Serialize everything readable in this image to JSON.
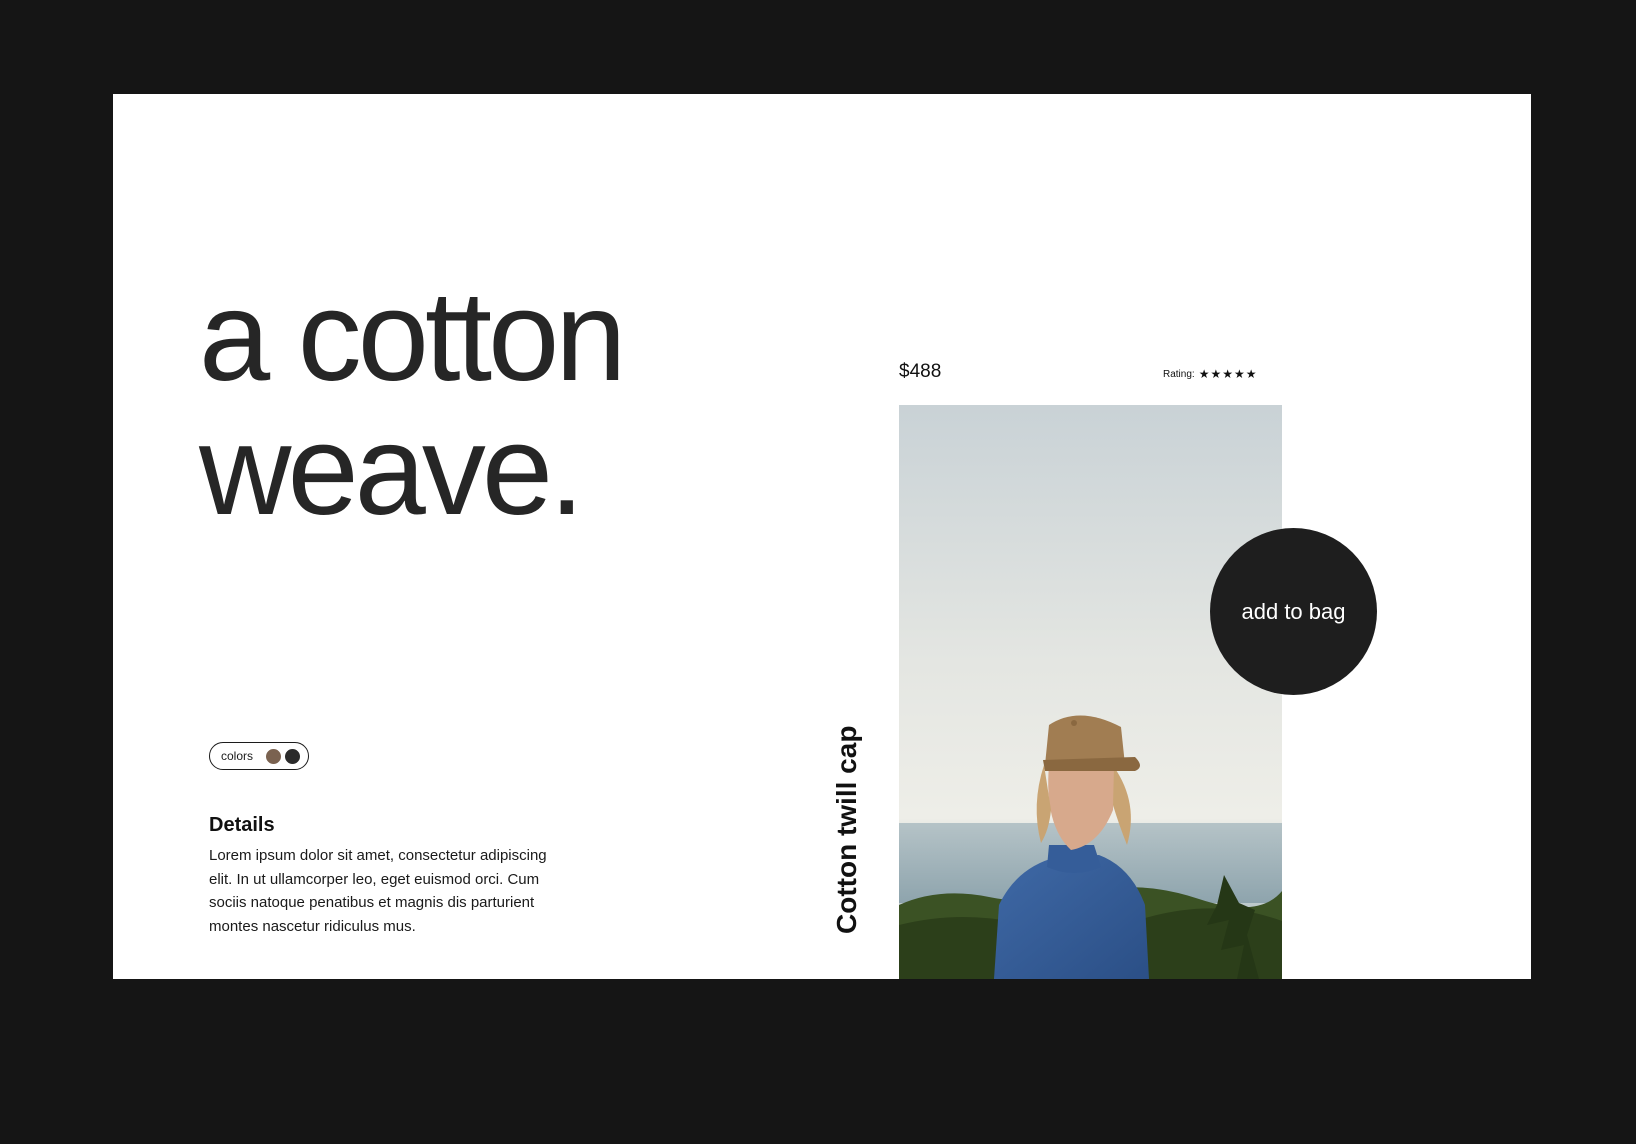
{
  "hero": {
    "line1": "a cotton",
    "line2": "weave."
  },
  "colors": {
    "label": "colors",
    "swatches": [
      {
        "name": "brown",
        "hex": "#7a6250"
      },
      {
        "name": "charcoal",
        "hex": "#2b2b2b"
      }
    ]
  },
  "details": {
    "title": "Details",
    "body": "Lorem ipsum dolor sit amet, consectetur adipiscing elit. In ut ullamcorper leo, eget euismod orci. Cum sociis natoque penatibus et magnis dis parturient montes nascetur ridiculus mus."
  },
  "product": {
    "price": "$488",
    "rating_label": "Rating:",
    "rating_stars": "★★★★★",
    "rating_value": 5,
    "name": "Cotton twill cap"
  },
  "actions": {
    "add_to_bag": "add to bag"
  },
  "theme": {
    "frame": "#151515",
    "card": "#ffffff",
    "button": "#1e1e1e"
  }
}
